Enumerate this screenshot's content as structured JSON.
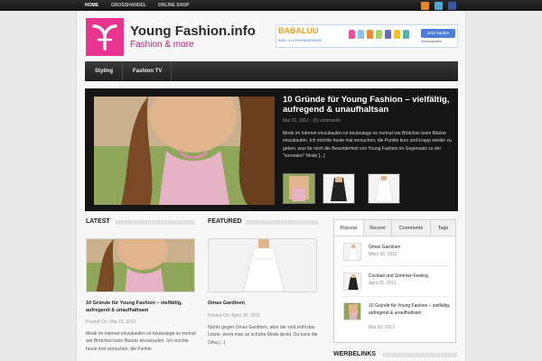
{
  "topnav": {
    "items": [
      "HOME",
      "GROSSHANDEL",
      "ONLINE SHOP"
    ]
  },
  "social": {
    "icons": [
      "rss-icon",
      "twitter-icon",
      "facebook-icon"
    ],
    "colors": [
      "#e3882c",
      "#4aa8d8",
      "#3b5998"
    ]
  },
  "header": {
    "title": "Young Fashion.info",
    "tagline": "Fashion & more",
    "accent": "#e8338f"
  },
  "banner": {
    "brand": "BABALUU",
    "sub": "BABY- & KLEINKINDERMODE",
    "button": "Jetzt kaufen",
    "shipping": "Versandkosten"
  },
  "mainnav": {
    "items": [
      "Styling",
      "Fashion TV"
    ]
  },
  "slider": {
    "title": "10 Gründe für Young Fashion – vielfältig, aufregend & unaufhaltsan",
    "meta": "Mai 23, 2012 - (0) comments",
    "excerpt": "Mode im Internet einzukaufen ist heutzutage so normal wie Brötchen beim Bäcker einzukaufen. Ich möchte heute mal versuchen, die Punkte kurz und knapp wieder zu geben, was für mich die Besonderheit von Young Fashion im Gegensatz zu der \"normalen\" Mode [...]"
  },
  "latest": {
    "heading": "LATEST",
    "title": "10 Gründe für Young Fashion – vielfältig, aufregend & unaufhaltsam",
    "meta": "Posted On: Mai 23, 2012",
    "excerpt": "Mode im Internet einzukaufen ist heutzutage so normal wie Brötchen beim Bäcker einzukaufen. Ich möchte heute mal versuchen, die Punkte"
  },
  "featured": {
    "heading": "FEATURED",
    "title": "Omas Gardinen",
    "meta": "Posted On: März 30, 2011",
    "excerpt": "Nichts gegen Omas Gardinen, aber die sind wohl das Letzte, wenn man an schicke Mode denkt. Da kann die Oma [...]"
  },
  "sidebar": {
    "tabs": [
      "Popular",
      "Recent",
      "Comments",
      "Tags"
    ],
    "items": [
      {
        "title": "Omas Gardinen",
        "date": "März 30, 2011"
      },
      {
        "title": "Cocktail und Sommer-Feeling",
        "date": "April 25, 2011"
      },
      {
        "title": "10 Gründe für Young Fashion – vielfältig, aufregend & unaufhaltsam",
        "date": "Mai 23, 2012"
      }
    ],
    "werbelinks": "WERBELINKS"
  }
}
